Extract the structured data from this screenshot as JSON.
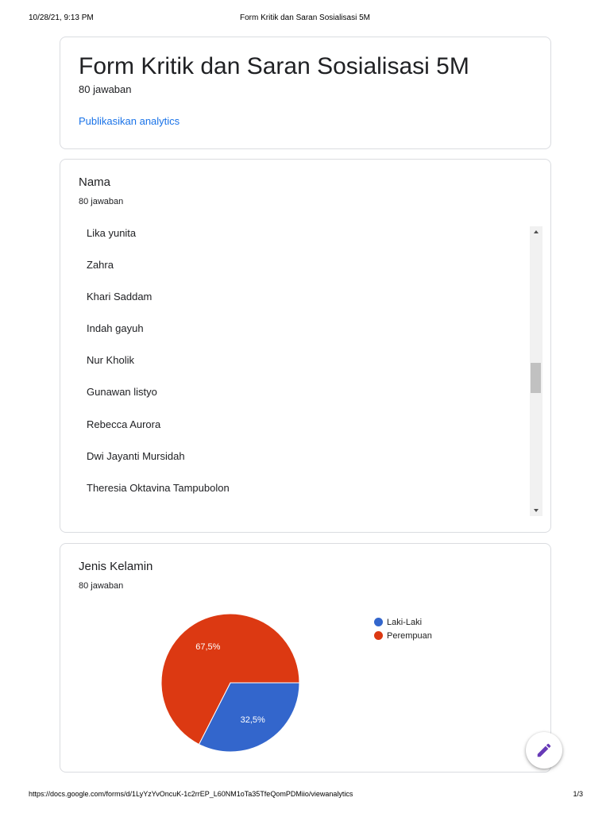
{
  "print_header": {
    "datetime": "10/28/21, 9:13 PM",
    "doc_title": "Form Kritik dan Saran Sosialisasi 5M"
  },
  "form": {
    "title": "Form Kritik dan Saran Sosialisasi 5M",
    "response_count": "80 jawaban",
    "publish_link": "Publikasikan analytics",
    "accent_color": "#1a73e8"
  },
  "question_nama": {
    "title": "Nama",
    "response_count": "80 jawaban",
    "answers": [
      "Lika yunita",
      "Zahra",
      "Khari Saddam",
      "Indah gayuh",
      "Nur Kholik",
      "Gunawan listyo",
      "Rebecca Aurora",
      "Dwi Jayanti Mursidah",
      "Theresia Oktavina Tampubolon"
    ]
  },
  "question_jenis_kelamin": {
    "title": "Jenis Kelamin",
    "response_count": "80 jawaban"
  },
  "chart_data": {
    "type": "pie",
    "title": "",
    "slices": [
      {
        "label": "Laki-Laki",
        "value": 32.5,
        "display": "32,5%",
        "color": "#3366cc"
      },
      {
        "label": "Perempuan",
        "value": 67.5,
        "display": "67,5%",
        "color": "#dc3912"
      }
    ],
    "legend_position": "right"
  },
  "fab": {
    "icon": "pencil-icon",
    "color": "#673ab7"
  },
  "print_footer": {
    "url": "https://docs.google.com/forms/d/1LyYzYvOncuK-1c2rrEP_L60NM1oTa35TfeQomPDMiio/viewanalytics",
    "page": "1/3"
  }
}
